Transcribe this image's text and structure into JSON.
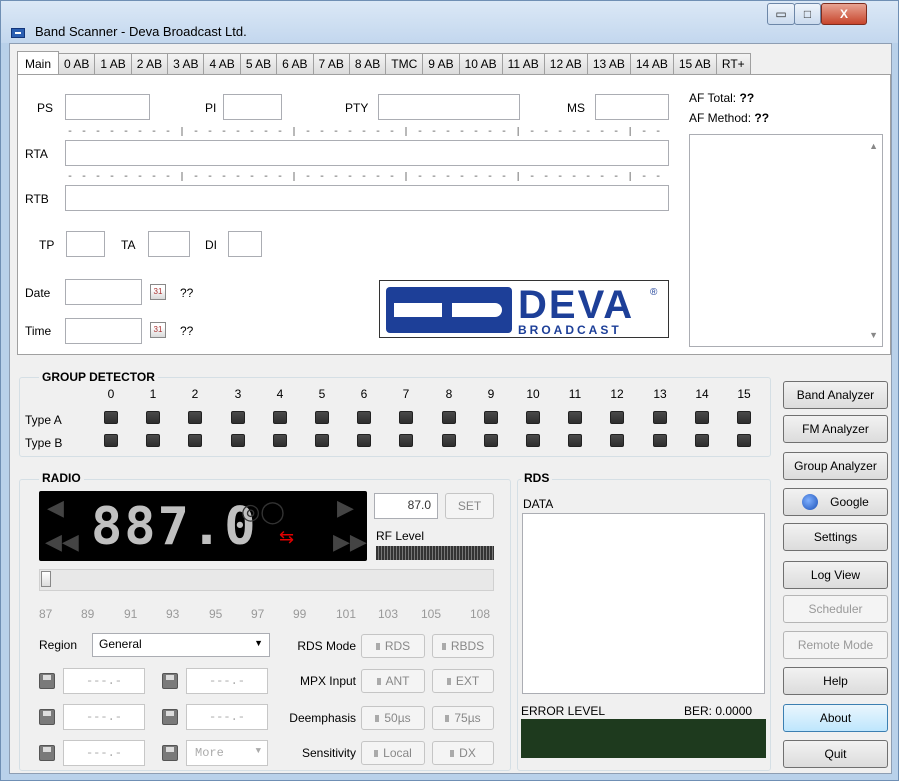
{
  "window": {
    "title": "Band Scanner  - Deva Broadcast Ltd.",
    "min": "▭",
    "max": "□",
    "close": "X"
  },
  "tabs": [
    "Main",
    "0 AB",
    "1 AB",
    "2 AB",
    "3 AB",
    "4 AB",
    "5 AB",
    "6 AB",
    "7 AB",
    "8 AB",
    "TMC",
    "9 AB",
    "10 AB",
    "11 AB",
    "12 AB",
    "13 AB",
    "14 AB",
    "15 AB",
    "RT+"
  ],
  "main": {
    "ps_label": "PS",
    "pi_label": "PI",
    "pty_label": "PTY",
    "ms_label": "MS",
    "rta_label": "RTA",
    "rtb_label": "RTB",
    "tp_label": "TP",
    "ta_label": "TA",
    "di_label": "DI",
    "date_label": "Date",
    "time_label": "Time",
    "date_value": "??",
    "time_value": "??",
    "af_total_label": "AF Total:",
    "af_total_value": "??",
    "af_method_label": "AF Method:",
    "af_method_value": "??",
    "ruler": "- - - - - - - - | - - - - - - - | - - - - - - - | - - - - - - - | - - - - - - - | - - - - - - - | - - - - - - - | - - - - - - - |"
  },
  "logo": {
    "word": "DEVA",
    "sub": "BROADCAST",
    "reg": "®"
  },
  "group_detector": {
    "title": "GROUP DETECTOR",
    "columns": [
      "0",
      "1",
      "2",
      "3",
      "4",
      "5",
      "6",
      "7",
      "8",
      "9",
      "10",
      "11",
      "12",
      "13",
      "14",
      "15"
    ],
    "row_a": "Type A",
    "row_b": "Type B"
  },
  "radio": {
    "title": "RADIO",
    "freq_display": "887.0",
    "freq_input": "87.0",
    "set_label": "SET",
    "rf_level_label": "RF Level",
    "ticks": [
      "87",
      "89",
      "91",
      "93",
      "95",
      "97",
      "99",
      "101",
      "103",
      "105",
      "108"
    ],
    "region_label": "Region",
    "region_value": "General",
    "memory_placeholder": "---.-",
    "more_label": "More",
    "rds_mode_label": "RDS Mode",
    "rds_label": "RDS",
    "rbds_label": "RBDS",
    "mpx_label": "MPX Input",
    "ant_label": "ANT",
    "ext_label": "EXT",
    "deemph_label": "Deemphasis",
    "d50_label": "50µs",
    "d75_label": "75µs",
    "sens_label": "Sensitivity",
    "local_label": "Local",
    "dx_label": "DX"
  },
  "rds": {
    "title": "RDS",
    "data_label": "DATA",
    "error_label": "ERROR LEVEL",
    "ber_label": "BER: 0.0000"
  },
  "side_buttons": {
    "band": "Band Analyzer",
    "fm": "FM Analyzer",
    "group": "Group Analyzer",
    "google": "Google",
    "settings": "Settings",
    "log": "Log View",
    "scheduler": "Scheduler",
    "remote": "Remote Mode",
    "help": "Help",
    "about": "About",
    "quit": "Quit"
  },
  "colors": {
    "frame": "#b9d1ea",
    "logo_blue": "#1d3f98",
    "led_off": "#3a3a3a",
    "usb_red": "#e00000"
  }
}
